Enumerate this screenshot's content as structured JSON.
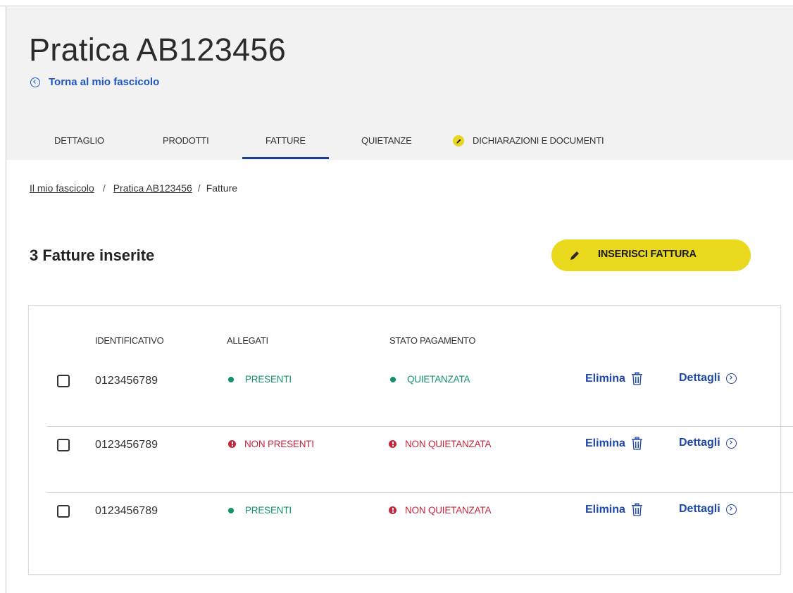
{
  "page": {
    "title": "Pratica AB123456",
    "back_link": "Torna al mio fascicolo"
  },
  "tabs": [
    {
      "label": "DETTAGLIO",
      "active": false
    },
    {
      "label": "PRODOTTI",
      "active": false
    },
    {
      "label": "FATTURE",
      "active": true
    },
    {
      "label": "QUIETANZE",
      "active": false
    },
    {
      "label": "DICHIARAZIONI E DOCUMENTI",
      "active": false,
      "icon": "pencil-icon"
    }
  ],
  "breadcrumb": [
    {
      "label": "Il mio fascicolo",
      "link": true
    },
    {
      "label": "Pratica AB123456",
      "link": true
    },
    {
      "label": "Fatture",
      "link": false
    }
  ],
  "invoices_section": {
    "count_title": "3 Fatture inserite",
    "insert_button": "INSERISCI FATTURA"
  },
  "table": {
    "columns": [
      "IDENTIFICATIVO",
      "ALLEGATI",
      "STATO PAGAMENTO"
    ],
    "rows": [
      {
        "id": "0123456789",
        "attachments": "PRESENTI",
        "attachments_state": "ok",
        "payment": "QUIETANZATA",
        "payment_state": "ok",
        "delete": "Elimina",
        "details": "Dettagli"
      },
      {
        "id": "0123456789",
        "attachments": "NON PRESENTI",
        "attachments_state": "bad",
        "payment": "NON QUIETANZATA",
        "payment_state": "bad",
        "delete": "Elimina",
        "details": "Dettagli"
      },
      {
        "id": "0123456789",
        "attachments": "PRESENTI",
        "attachments_state": "ok",
        "payment": "NON QUIETANZATA",
        "payment_state": "bad",
        "delete": "Elimina",
        "details": "Dettagli"
      }
    ]
  },
  "colors": {
    "accent_yellow": "#e9d81b",
    "link_blue": "#1e56c8",
    "tab_underline": "#1d3f8f",
    "ok_green": "#12926b",
    "error_red": "#c8243a",
    "header_bg": "#f2f2f2"
  }
}
